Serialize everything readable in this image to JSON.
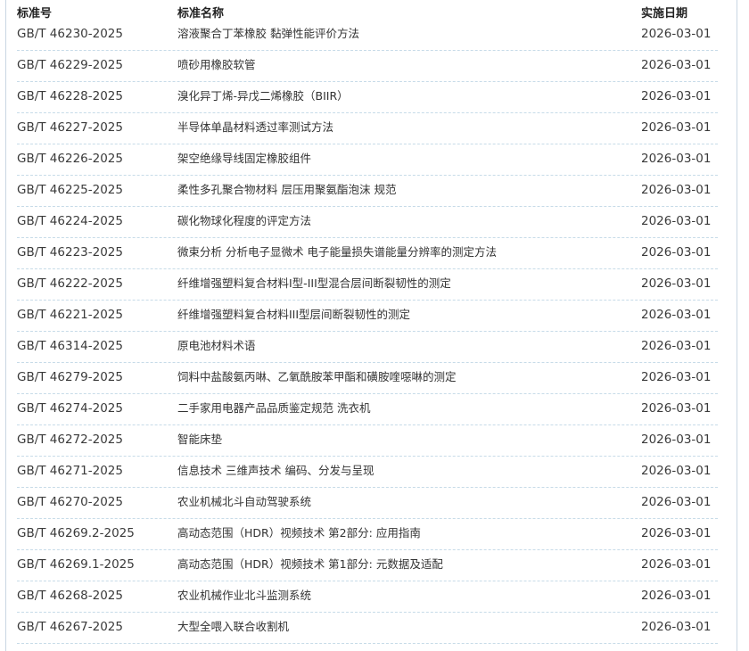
{
  "table": {
    "headers": {
      "code": "标准号",
      "name": "标准名称",
      "date": "实施日期"
    },
    "rows": [
      {
        "code": "GB/T 46230-2025",
        "name": "溶液聚合丁苯橡胶 黏弹性能评价方法",
        "date": "2026-03-01"
      },
      {
        "code": "GB/T 46229-2025",
        "name": "喷砂用橡胶软管",
        "date": "2026-03-01"
      },
      {
        "code": "GB/T 46228-2025",
        "name": "溴化异丁烯-异戊二烯橡胶（BIIR）",
        "date": "2026-03-01"
      },
      {
        "code": "GB/T 46227-2025",
        "name": "半导体单晶材料透过率测试方法",
        "date": "2026-03-01"
      },
      {
        "code": "GB/T 46226-2025",
        "name": "架空绝缘导线固定橡胶组件",
        "date": "2026-03-01"
      },
      {
        "code": "GB/T 46225-2025",
        "name": "柔性多孔聚合物材料 层压用聚氨酯泡沫 规范",
        "date": "2026-03-01"
      },
      {
        "code": "GB/T 46224-2025",
        "name": "碳化物球化程度的评定方法",
        "date": "2026-03-01"
      },
      {
        "code": "GB/T 46223-2025",
        "name": "微束分析 分析电子显微术 电子能量损失谱能量分辨率的测定方法",
        "date": "2026-03-01"
      },
      {
        "code": "GB/T 46222-2025",
        "name": "纤维增强塑料复合材料I型-III型混合层间断裂韧性的测定",
        "date": "2026-03-01"
      },
      {
        "code": "GB/T 46221-2025",
        "name": "纤维增强塑料复合材料III型层间断裂韧性的测定",
        "date": "2026-03-01"
      },
      {
        "code": "GB/T 46314-2025",
        "name": "原电池材料术语",
        "date": "2026-03-01"
      },
      {
        "code": "GB/T 46279-2025",
        "name": "饲料中盐酸氨丙啉、乙氧酰胺苯甲酯和磺胺喹噁啉的测定",
        "date": "2026-03-01"
      },
      {
        "code": "GB/T 46274-2025",
        "name": "二手家用电器产品品质鉴定规范 洗衣机",
        "date": "2026-03-01"
      },
      {
        "code": "GB/T 46272-2025",
        "name": "智能床垫",
        "date": "2026-03-01"
      },
      {
        "code": "GB/T 46271-2025",
        "name": "信息技术 三维声技术 编码、分发与呈现",
        "date": "2026-03-01"
      },
      {
        "code": "GB/T 46270-2025",
        "name": "农业机械北斗自动驾驶系统",
        "date": "2026-03-01"
      },
      {
        "code": "GB/T 46269.2-2025",
        "name": "高动态范围（HDR）视频技术 第2部分: 应用指南",
        "date": "2026-03-01"
      },
      {
        "code": "GB/T 46269.1-2025",
        "name": "高动态范围（HDR）视频技术 第1部分: 元数据及适配",
        "date": "2026-03-01"
      },
      {
        "code": "GB/T 46268-2025",
        "name": "农业机械作业北斗监测系统",
        "date": "2026-03-01"
      },
      {
        "code": "GB/T 46267-2025",
        "name": "大型全喂入联合收割机",
        "date": "2026-03-01"
      }
    ]
  }
}
